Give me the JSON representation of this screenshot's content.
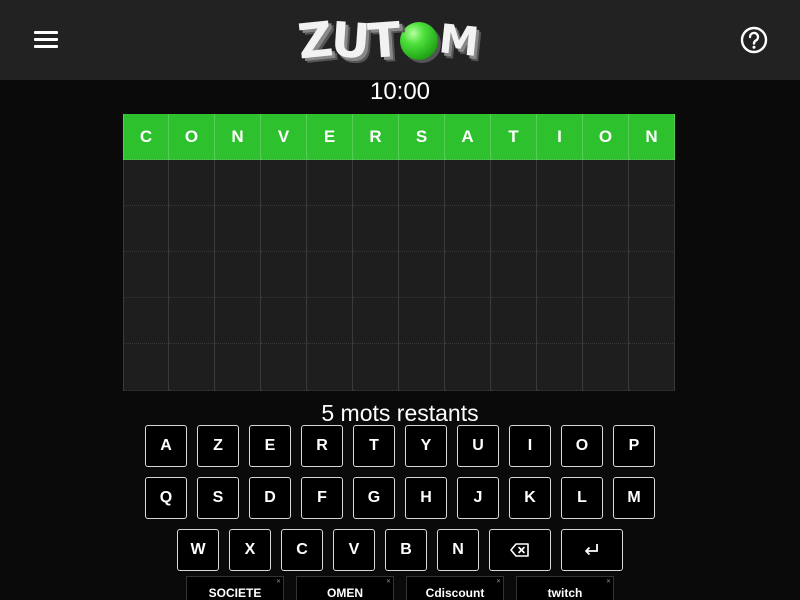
{
  "header": {
    "logo_letters": [
      "Z",
      "U",
      "T",
      "M"
    ],
    "colors": {
      "bar": "#222222",
      "ball": "#4de03c"
    }
  },
  "game": {
    "timer": "10:00",
    "word": [
      "C",
      "O",
      "N",
      "V",
      "E",
      "R",
      "S",
      "A",
      "T",
      "I",
      "O",
      "N"
    ],
    "columns": 12,
    "empty_rows": 5,
    "correct_color": "#2dc22d",
    "remaining_text": "5 mots restants"
  },
  "keyboard": {
    "row1": [
      "A",
      "Z",
      "E",
      "R",
      "T",
      "Y",
      "U",
      "I",
      "O",
      "P"
    ],
    "row2": [
      "Q",
      "S",
      "D",
      "F",
      "G",
      "H",
      "J",
      "K",
      "L",
      "M"
    ],
    "row3": [
      "W",
      "X",
      "C",
      "V",
      "B",
      "N"
    ],
    "backspace_icon": "backspace-icon",
    "enter_icon": "enter-icon"
  },
  "ads": [
    "SOCIETE",
    "OMEN",
    "Cdiscount",
    "twitch"
  ]
}
